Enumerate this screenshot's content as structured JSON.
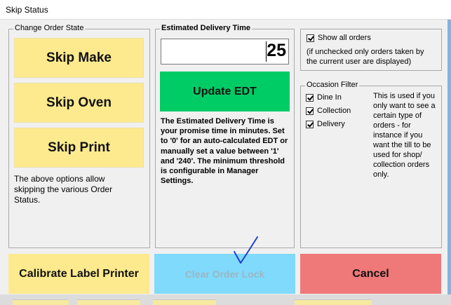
{
  "window": {
    "title": "Skip Status"
  },
  "change_order_state": {
    "group_label": "Change Order State",
    "skip_make": "Skip Make",
    "skip_oven": "Skip Oven",
    "skip_print": "Skip Print",
    "description": "The above options allow skipping the various Order Status."
  },
  "edt": {
    "group_label": "Estimated Delivery Time",
    "value": "25",
    "update_button": "Update EDT",
    "note": "The Estimated Delivery Time is your promise time in minutes. Set to '0' for an auto-calculated EDT or manually set a value between '1' and '240'. The minimum threshold is configurable in Manager Settings."
  },
  "show_all_orders": {
    "label": "Show all orders",
    "checked": true,
    "note": "(if unchecked only orders taken by the current user are displayed)"
  },
  "occasion_filter": {
    "group_label": "Occasion Filter",
    "options": [
      {
        "label": "Dine In",
        "checked": true
      },
      {
        "label": "Collection",
        "checked": true
      },
      {
        "label": "Delivery",
        "checked": true
      }
    ],
    "note": "This is used if you only want to see a certain type of orders - for instance if you want the till to be used for shop/ collection orders only."
  },
  "actions": {
    "calibrate": "Calibrate Label Printer",
    "clear_lock": "Clear Order Lock",
    "cancel": "Cancel"
  },
  "colors": {
    "yellow": "#fdea8e",
    "green": "#00cc66",
    "light_blue": "#7fdafc",
    "red": "#ef7878"
  }
}
